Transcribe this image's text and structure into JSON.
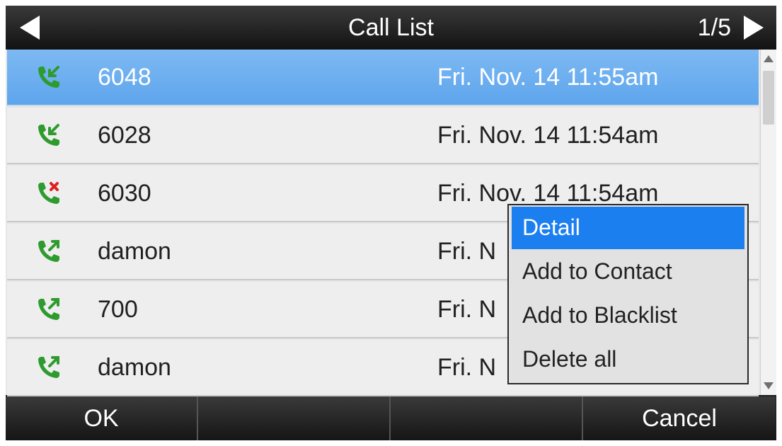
{
  "header": {
    "title": "Call List",
    "page": "1/5"
  },
  "calls": [
    {
      "name": "6048",
      "time": "Fri. Nov. 14 11:55am",
      "type": "incoming",
      "selected": true
    },
    {
      "name": "6028",
      "time": "Fri. Nov. 14 11:54am",
      "type": "incoming",
      "selected": false
    },
    {
      "name": "6030",
      "time": "Fri. Nov. 14 11:54am",
      "type": "missed",
      "selected": false
    },
    {
      "name": "damon",
      "time": "Fri. N",
      "type": "outgoing",
      "selected": false
    },
    {
      "name": "700",
      "time": "Fri. N",
      "type": "outgoing",
      "selected": false
    },
    {
      "name": "damon",
      "time": "Fri. N",
      "type": "outgoing",
      "selected": false
    }
  ],
  "context_menu": {
    "items": [
      "Detail",
      "Add to Contact",
      "Add to Blacklist",
      "Delete all"
    ],
    "selected_index": 0
  },
  "softkeys": [
    "OK",
    "",
    "",
    "Cancel"
  ],
  "colors": {
    "selection": "#6aacee",
    "menu_highlight": "#1c7ff0",
    "call_icon_green": "#2e9b2e",
    "missed_x_red": "#e02020"
  },
  "icons": {
    "incoming": "incoming-call-icon",
    "missed": "missed-call-icon",
    "outgoing": "outgoing-call-icon"
  }
}
